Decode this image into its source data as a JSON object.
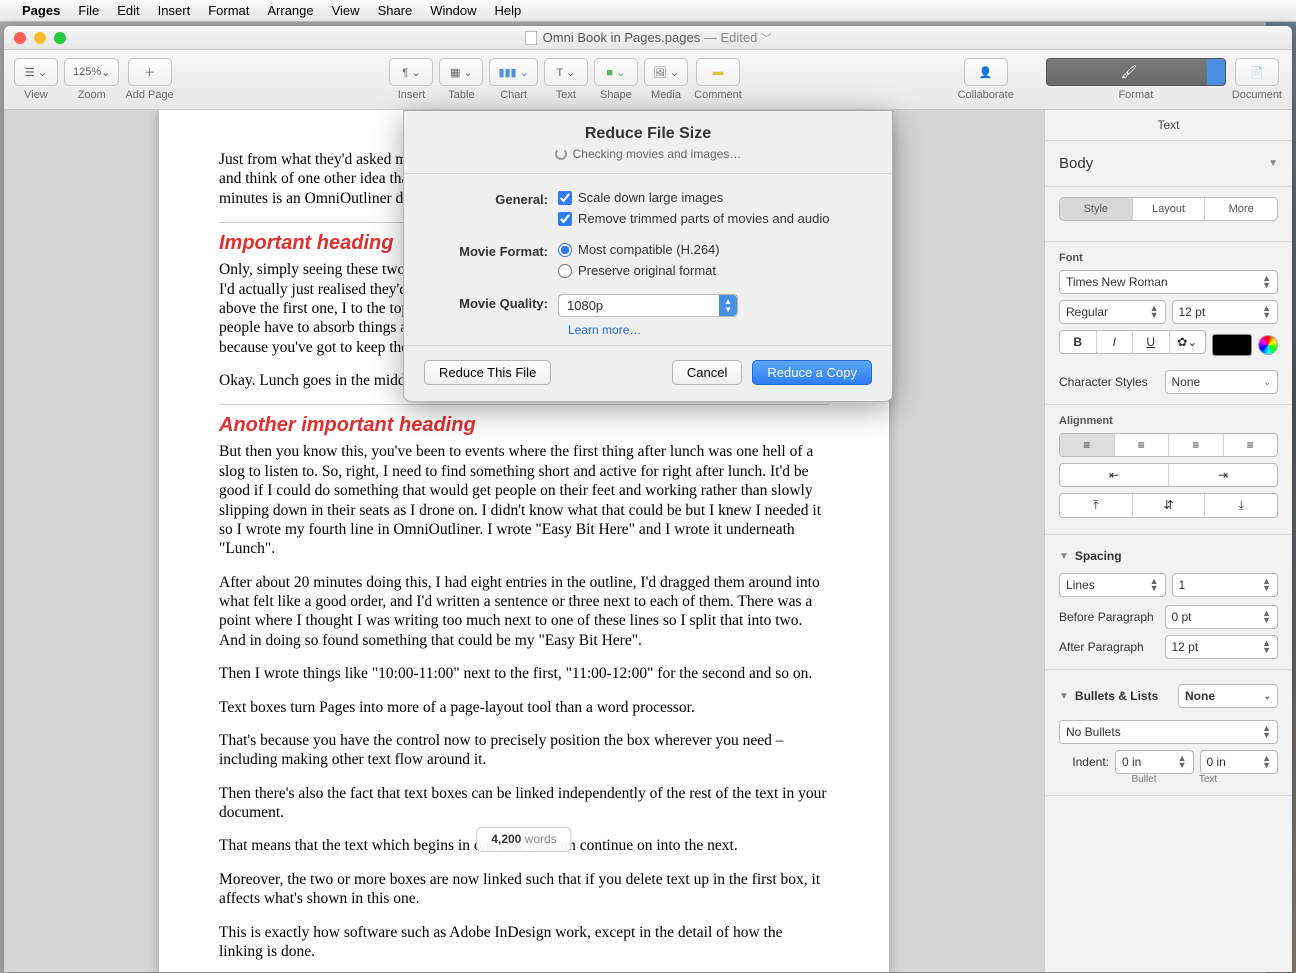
{
  "menubar": {
    "app": "Pages",
    "items": [
      "File",
      "Edit",
      "Insert",
      "Format",
      "Arrange",
      "View",
      "Share",
      "Window",
      "Help"
    ]
  },
  "window": {
    "title": "Omni Book in Pages.pages",
    "edited": "— Edited"
  },
  "toolbar": {
    "view": "View",
    "zoom_value": "125%",
    "zoom": "Zoom",
    "add_page": "Add Page",
    "insert": "Insert",
    "table": "Table",
    "chart": "Chart",
    "text": "Text",
    "shape": "Shape",
    "media": "Media",
    "comment": "Comment",
    "collaborate": "Collaborate",
    "format": "Format",
    "document": "Document"
  },
  "document": {
    "p1": "Just from what they'd asked me to do would cover a couple of hours. Then I had to take a breath and think of one other idea that I felt would be a good fit. That what they'd get to see in about ten minutes is an OmniOutliner document with the following headings already written:",
    "h1": "Important heading",
    "p2": "Only, simply seeing these two written down next to each other — in the outline — I realised that I'd actually just realised they'd work better the other way around. So I dragged the second one up above the first one, I to the top. As I was doing that, 'Lunch' — you need one, I thought, because people have to absorb things and you want to give attention to them. I then held it in place because you've got to keep them interested and stretched it out to about 20 minutes.",
    "p3": "Okay. Lunch goes in the middle.",
    "h2": "Another important heading",
    "p4": "But then you know this, you've been to events where the first thing after lunch was one hell of a slog to listen to. So, right, I need to find something short and active for right after lunch. It'd be good if I could do something that would get people on their feet and working rather than slowly slipping down in their seats as I drone on. I didn't know what that could be but I knew I needed it so I wrote my fourth line in OmniOutliner. I wrote \"Easy Bit Here\" and I wrote it underneath \"Lunch\".",
    "p5": "After about 20 minutes doing this, I had eight entries in the outline, I'd dragged them around into what felt like a good order, and I'd written a sentence or three next to each of them. There was a point where I thought I was writing too much next to one of these lines so I split that into two. And in doing so found something that could be my \"Easy Bit Here\".",
    "p6": "Then I wrote things like \"10:00-11:00\" next to the first, \"11:00-12:00\" for the second and so on.",
    "p7": "Text boxes turn Pages into more of a page-layout tool than a word processor.",
    "p8": "That's because you have the control now to precisely position the box wherever you need – including making other text flow around it.",
    "p9": "Then there's also the fact that text boxes can be linked independently of the rest of the text in your document.",
    "p10": "That means that the text which begins in one text box can continue on into the next.",
    "p11": "Moreover, the two or more boxes are now linked such that if you delete text up in the first box, it affects what's shown in this one.",
    "p12": "This is exactly how software such as Adobe InDesign work, except in the detail of how the linking is done.",
    "word_count": "4,200",
    "word_label": "words"
  },
  "dialog": {
    "title": "Reduce File Size",
    "status": "Checking movies and images…",
    "general_label": "General:",
    "scale_down": "Scale down large images",
    "remove_trimmed": "Remove trimmed parts of movies and audio",
    "movie_format_label": "Movie Format:",
    "most_compat": "Most compatible (H.264)",
    "preserve": "Preserve original format",
    "movie_quality_label": "Movie Quality:",
    "quality_value": "1080p",
    "learn": "Learn more…",
    "reduce_this": "Reduce This File",
    "cancel": "Cancel",
    "reduce_copy": "Reduce a Copy"
  },
  "inspector": {
    "tab": "Text",
    "style_name": "Body",
    "seg_style": "Style",
    "seg_layout": "Layout",
    "seg_more": "More",
    "font_label": "Font",
    "font_family": "Times New Roman",
    "font_style": "Regular",
    "font_size": "12 pt",
    "char_styles_label": "Character Styles",
    "char_styles_value": "None",
    "align_label": "Alignment",
    "spacing_label": "Spacing",
    "spacing_mode": "Lines",
    "spacing_value": "1",
    "before_label": "Before Paragraph",
    "before_value": "0 pt",
    "after_label": "After Paragraph",
    "after_value": "12 pt",
    "bullets_label": "Bullets & Lists",
    "bullets_value": "None",
    "bullets_style": "No Bullets",
    "indent_label": "Indent:",
    "indent_bullet": "0 in",
    "indent_text": "0 in",
    "bullet_sub": "Bullet",
    "text_sub": "Text"
  }
}
